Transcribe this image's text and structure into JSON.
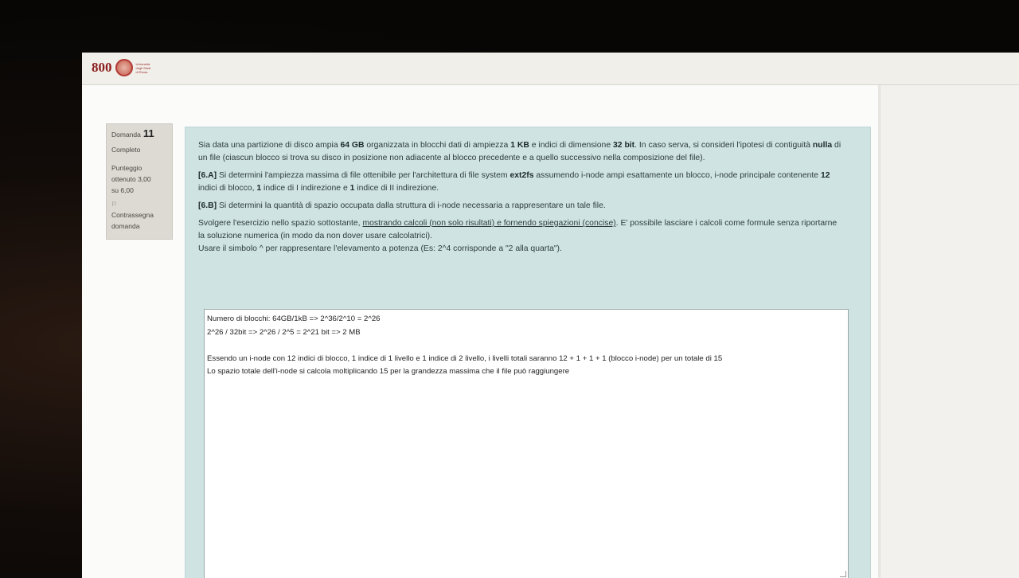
{
  "logo": {
    "number": "800",
    "text": [
      "Università",
      "degli Studi",
      "di Roma"
    ]
  },
  "question_info": {
    "label": "Domanda",
    "number": "11",
    "status": "Completo",
    "score_lines": [
      "Punteggio",
      "ottenuto 3,00",
      "su 6,00"
    ],
    "flag_icon": "flag-icon",
    "flag_lines": [
      "Contrassegna",
      "domanda"
    ]
  },
  "question": {
    "intro": {
      "t1": "Sia data una partizione di disco ampia ",
      "b1": "64 GB",
      "t2": " organizzata in blocchi dati di ampiezza ",
      "b2": "1 KB",
      "t3": " e indici di dimensione ",
      "b3": "32 bit",
      "t4": ". In caso serva, si consideri l'ipotesi di contiguità ",
      "b4": "nulla",
      "t5": " di un file (ciascun blocco si trova su disco in posizione non adiacente al blocco precedente e a quello successivo nella composizione del file)."
    },
    "part_a": {
      "tag": "[6.A]",
      "t1": " Si determini l'ampiezza massima di file ottenibile per l'architettura di file system ",
      "b1": "ext2fs",
      "t2": " assumendo i-node ampi esattamente un blocco, i-node principale contenente ",
      "b2": "12",
      "t3": " indici di blocco, ",
      "b3": "1",
      "t4": " indice di I indirezione e ",
      "b4": "1",
      "t5": " indice di II indirezione."
    },
    "part_b": {
      "tag": "[6.B]",
      "t1": " Si determini la quantità di spazio occupata dalla struttura di i-node necessaria a rappresentare un tale file."
    },
    "instructions": {
      "t1": "Svolgere l'esercizio nello spazio sottostante, ",
      "u1": "mostrando calcoli (non solo risultati) e fornendo spiegazioni (concise)",
      "t2": ". E' possibile lasciare i calcoli come formule senza riportarne la soluzione numerica (in modo da non dover usare calcolatrici).",
      "t3": "Usare il simbolo ^ per rappresentare l'elevamento a potenza (Es: 2^4 corrisponde a \"2 alla quarta\")."
    }
  },
  "answer": {
    "lines": [
      "Numero di blocchi: 64GB/1kB => 2^36/2^10 = 2^26",
      "2^26 / 32bit => 2^26 / 2^5 = 2^21 bit => 2 MB",
      "",
      "Essendo un i-node con 12 indici di blocco, 1 indice di 1 livello e 1 indice di 2 livello, i livelli totali saranno 12 + 1 + 1 + 1 (blocco i-node) per un totale di 15",
      "Lo spazio totale dell'i-node si calcola moltiplicando 15 per la grandezza massima che il file può raggiungere"
    ]
  }
}
